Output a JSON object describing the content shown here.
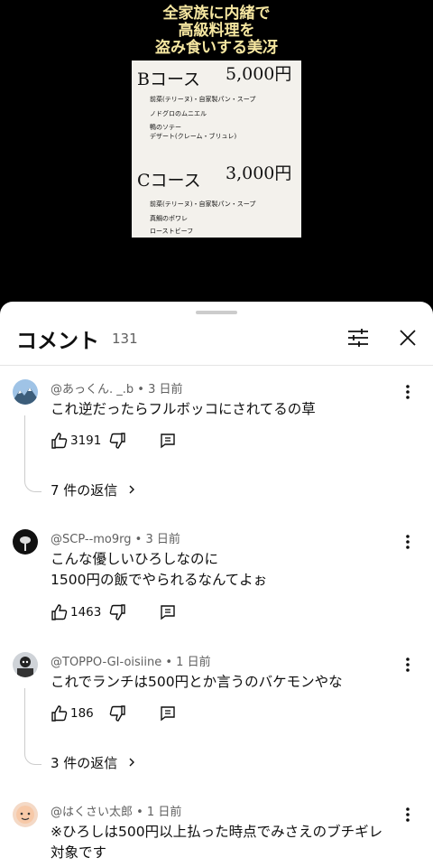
{
  "video": {
    "caption_lines": [
      "全家族に内緒で",
      "高級料理を",
      "盗み食いする美冴"
    ],
    "menu": {
      "courses": [
        {
          "name": "Bコース",
          "price": "5,000円",
          "items": [
            "前菜(テリーヌ)・自家製パン・スープ",
            "ノドグロのムニエル",
            "鴨のソテー",
            "デザート(クレーム・ブリュレ)"
          ]
        },
        {
          "name": "Cコース",
          "price": "3,000円",
          "items": [
            "前菜(テリーヌ)・自家製パン・スープ",
            "真鯛のポワレ",
            "ローストビーフ"
          ]
        }
      ]
    }
  },
  "header": {
    "title": "コメント",
    "count": "131"
  },
  "comments": [
    {
      "author": "@あっくん. _.b • 3 日前",
      "text": "これ逆だったらフルボッコにされてるの草",
      "likes": "3191",
      "replies": "7 件の返信"
    },
    {
      "author": "@SCP--mo9rg • 3 日前",
      "text": "こんな優しいひろしなのに\n1500円の飯でやられるなんてよぉ",
      "likes": "1463",
      "replies": ""
    },
    {
      "author": "@TOPPO-GI-oisiine • 1 日前",
      "text": "これでランチは500円とか言うのバケモンやな",
      "likes": "186",
      "replies": "3 件の返信"
    },
    {
      "author": "@はくさい太郎 • 1 日前",
      "text": "※ひろしは500円以上払った時点でみさえのブチギレ\n対象です",
      "likes": "",
      "replies": ""
    }
  ],
  "icons": {
    "filter": "tune-icon",
    "close": "close-icon",
    "like": "thumb-up-icon",
    "dislike": "thumb-down-icon",
    "reply": "comment-reply-icon",
    "more": "more-vert-icon",
    "chevron": "chevron-right-icon"
  }
}
